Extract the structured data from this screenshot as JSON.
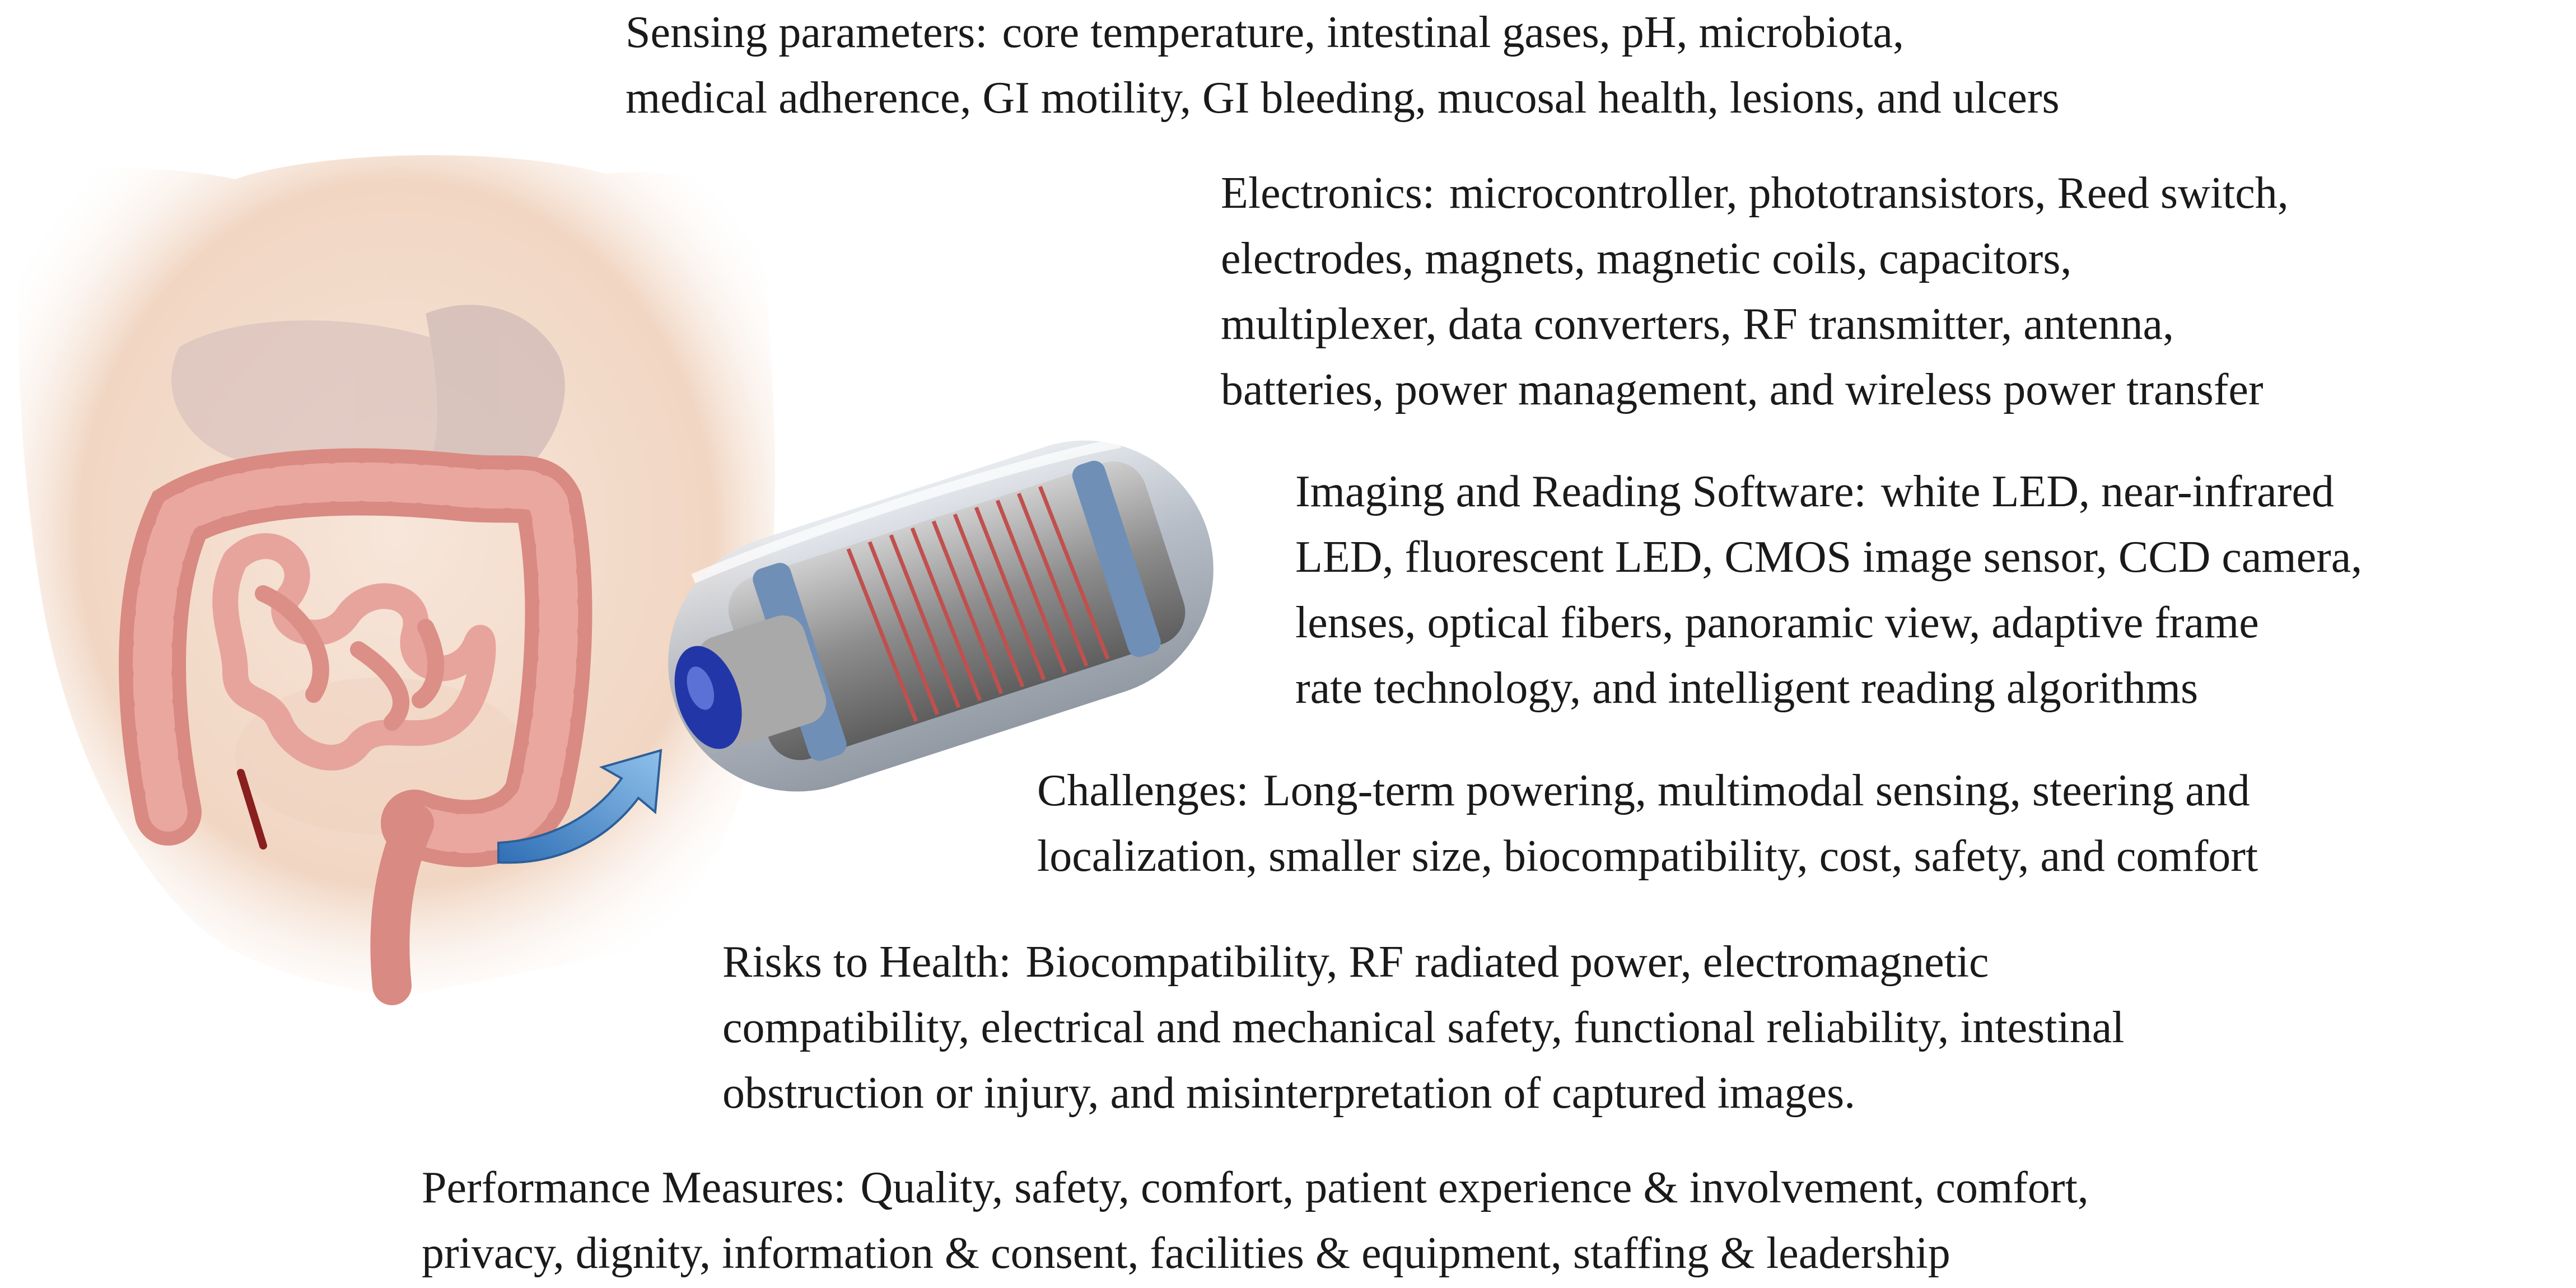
{
  "blocks": [
    {
      "id": "sensing",
      "label": "Sensing parameters:",
      "lines": [
        "core temperature, intestinal gases, pH, microbiota,",
        "medical adherence, GI motility, GI bleeding, mucosal health, lesions, and ulcers"
      ]
    },
    {
      "id": "electronics",
      "label": "Electronics:",
      "lines": [
        "microcontroller, phototransistors, Reed switch,",
        "electrodes, magnets, magnetic coils, capacitors,",
        "multiplexer, data converters, RF transmitter, antenna,",
        "batteries, power management, and wireless power transfer"
      ]
    },
    {
      "id": "imaging",
      "label": "Imaging and Reading Software:",
      "lines": [
        "white LED, near-infrared",
        "LED, fluorescent LED, CMOS image sensor, CCD camera,",
        "lenses, optical fibers, panoramic view, adaptive frame",
        "rate technology, and intelligent reading algorithms"
      ]
    },
    {
      "id": "challenges",
      "label": "Challenges:",
      "lines": [
        "Long-term powering, multimodal sensing, steering and",
        "localization, smaller size, biocompatibility, cost, safety, and comfort"
      ]
    },
    {
      "id": "risks",
      "label": "Risks to Health:",
      "lines": [
        "Biocompatibility, RF radiated power, electromagnetic",
        "compatibility, electrical and mechanical safety, functional reliability, intestinal",
        "obstruction or injury, and misinterpretation of captured images."
      ]
    },
    {
      "id": "performance",
      "label": "Performance Measures:",
      "lines": [
        "Quality, safety, comfort, patient experience & involvement, comfort,",
        "privacy, dignity, information & consent, facilities & equipment, staffing & leadership"
      ]
    }
  ],
  "colors": {
    "skin": "#f3dccb",
    "intestine": "#e39a92",
    "capsule_shell": "#b9c0c9",
    "capsule_ring": "#6f8fb6",
    "coil": "#c0504d",
    "lens": "#2336a8",
    "arrow": "#4a84c8"
  }
}
